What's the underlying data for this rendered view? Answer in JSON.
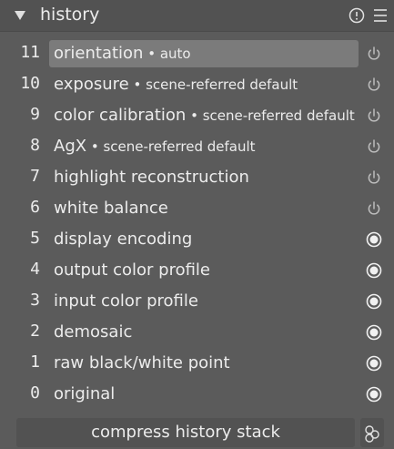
{
  "panel": {
    "title": "history",
    "header_icons": [
      "collapse-arrow-icon",
      "info-icon",
      "menu-icon"
    ]
  },
  "history": {
    "items": [
      {
        "number": "11",
        "label": "orientation",
        "sub": " • auto",
        "status": "off",
        "selected": true
      },
      {
        "number": "10",
        "label": "exposure",
        "sub": " • scene-referred default",
        "status": "off",
        "selected": false
      },
      {
        "number": "9",
        "label": "color calibration",
        "sub": " • scene-referred default",
        "status": "off",
        "selected": false
      },
      {
        "number": "8",
        "label": "AgX",
        "sub": " • scene-referred default",
        "status": "off",
        "selected": false
      },
      {
        "number": "7",
        "label": "highlight reconstruction",
        "sub": "",
        "status": "off",
        "selected": false
      },
      {
        "number": "6",
        "label": "white balance",
        "sub": "",
        "status": "off",
        "selected": false
      },
      {
        "number": "5",
        "label": "display encoding",
        "sub": "",
        "status": "on",
        "selected": false
      },
      {
        "number": "4",
        "label": "output color profile",
        "sub": "",
        "status": "on",
        "selected": false
      },
      {
        "number": "3",
        "label": "input color profile",
        "sub": "",
        "status": "on",
        "selected": false
      },
      {
        "number": "2",
        "label": "demosaic",
        "sub": "",
        "status": "on",
        "selected": false
      },
      {
        "number": "1",
        "label": "raw black/white point",
        "sub": "",
        "status": "on",
        "selected": false
      },
      {
        "number": "0",
        "label": "original",
        "sub": "",
        "status": "on",
        "selected": false
      }
    ]
  },
  "footer": {
    "compress_label": "compress history stack",
    "snapshot_icon": "snapshot-circles-icon"
  },
  "colors": {
    "panel_bg": "#5b5b5b",
    "header_bg": "#525252",
    "selected_bg": "#7b7b7b",
    "text": "#ececec"
  }
}
